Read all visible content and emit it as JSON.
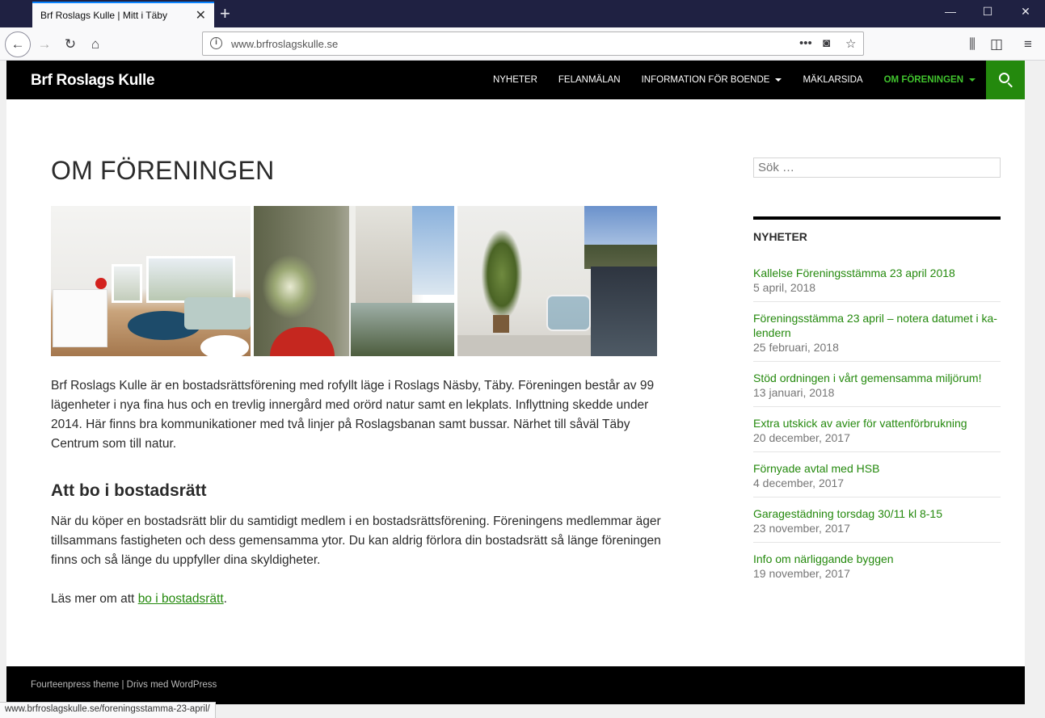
{
  "browser": {
    "tab_title": "Brf Roslags Kulle | Mitt i Täby",
    "url": "www.brfroslagskulle.se",
    "status_url": "www.brfroslagskulle.se/foreningsstamma-23-april/"
  },
  "site": {
    "title": "Brf Roslags Kulle",
    "menu": [
      {
        "label": "NYHETER",
        "dropdown": false,
        "active": false
      },
      {
        "label": "FELANMÄLAN",
        "dropdown": false,
        "active": false
      },
      {
        "label": "INFORMATION FÖR BOENDE",
        "dropdown": true,
        "active": false
      },
      {
        "label": "MÄKLARSIDA",
        "dropdown": false,
        "active": false
      },
      {
        "label": "OM FÖRENINGEN",
        "dropdown": true,
        "active": true
      }
    ],
    "accent_color": "#24890d",
    "active_menu_color": "#41c42e"
  },
  "article": {
    "title": "OM FÖRENINGEN",
    "intro": "Brf Roslags Kulle är en bostadsrättsförening med rofyllt läge i Roslags Näsby, Täby. Föreningen består av 99 lägenheter i nya fina hus och en trevlig innergård med orörd natur samt en lekplats. Inflyttning skedde under 2014. Här finns bra kommunikationer med två linjer på Roslagsbanan samt bussar. Närhet till såväl Täby Centrum som till natur.",
    "section_heading": "Att bo i bostadsrätt",
    "section_body": "När du köper en bostadsrätt blir du samtidigt medlem i en bostadsrättsförening. Föreningens medlem­mar äger tillsammans fastigheten och dess gemensamma ytor. Du kan aldrig förlora din bostadsrätt så länge föreningen finns och så länge du uppfyller dina skyldigheter.",
    "read_more_prefix": "Läs mer om att ",
    "read_more_link": "bo i bostadsrätt",
    "read_more_suffix": "."
  },
  "sidebar": {
    "search_placeholder": "Sök …",
    "widget_title": "NYHETER",
    "news": [
      {
        "title": "Kallelse Föreningsstämma 23 april 2018",
        "date": "5 april, 2018"
      },
      {
        "title": "Föreningsstämma 23 april – notera datumet i ka­lendern",
        "date": "25 februari, 2018"
      },
      {
        "title": "Stöd ordningen i vårt gemensamma miljörum!",
        "date": "13 januari, 2018"
      },
      {
        "title": "Extra utskick av avier för vattenförbrukning",
        "date": "20 december, 2017"
      },
      {
        "title": "Förnyade avtal med HSB",
        "date": "4 december, 2017"
      },
      {
        "title": "Garagestädning torsdag 30/11 kl 8-15",
        "date": "23 november, 2017"
      },
      {
        "title": "Info om närliggande byggen",
        "date": "19 november, 2017"
      }
    ]
  },
  "footer": {
    "text": "Fourteenpress theme | Drivs med WordPress"
  }
}
